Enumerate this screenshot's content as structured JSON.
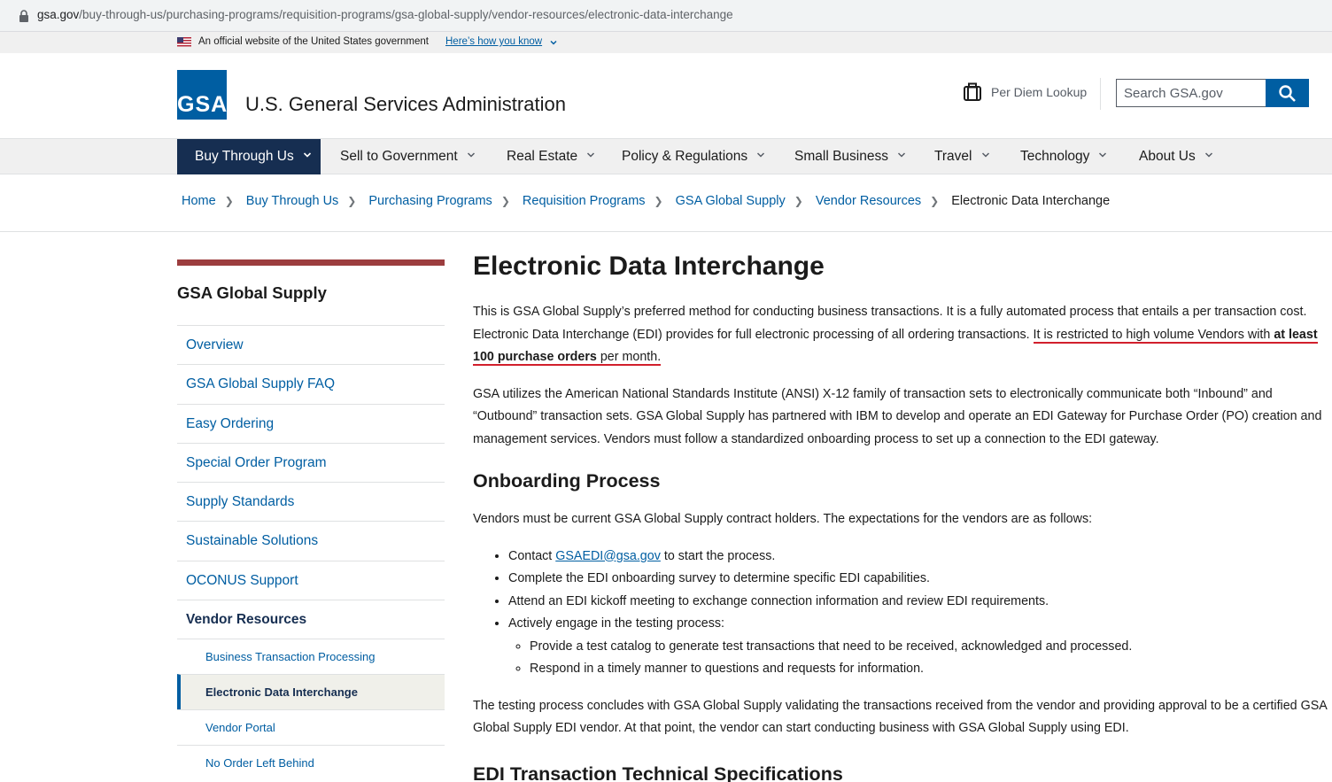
{
  "browser": {
    "url_host": "gsa.gov",
    "url_path": "/buy-through-us/purchasing-programs/requisition-programs/gsa-global-supply/vendor-resources/electronic-data-interchange"
  },
  "gov_banner": {
    "text": "An official website of the United States government",
    "link": "Here’s how you know"
  },
  "header": {
    "logo_text": "GSA",
    "agency_name": "U.S. General Services Administration",
    "per_diem": "Per Diem Lookup",
    "search_placeholder": "Search GSA.gov"
  },
  "nav": {
    "items": [
      {
        "label": "Buy Through Us",
        "active": true
      },
      {
        "label": "Sell to Government"
      },
      {
        "label": "Real Estate"
      },
      {
        "label": "Policy & Regulations"
      },
      {
        "label": "Small Business"
      },
      {
        "label": "Travel"
      },
      {
        "label": "Technology"
      },
      {
        "label": "About Us"
      }
    ]
  },
  "breadcrumb": {
    "items": [
      "Home",
      "Buy Through Us",
      "Purchasing Programs",
      "Requisition Programs",
      "GSA Global Supply",
      "Vendor Resources"
    ],
    "current": "Electronic Data Interchange"
  },
  "sidebar": {
    "title": "GSA Global Supply",
    "items": [
      "Overview",
      "GSA Global Supply FAQ",
      "Easy Ordering",
      "Special Order Program",
      "Supply Standards",
      "Sustainable Solutions",
      "OCONUS Support",
      "Vendor Resources"
    ],
    "subitems": [
      "Business Transaction Processing",
      "Electronic Data Interchange",
      "Vendor Portal",
      "No Order Left Behind"
    ]
  },
  "main": {
    "title": "Electronic Data Interchange",
    "p1_a": "This is GSA Global Supply’s preferred method for conducting business transactions. It is a fully automated process that entails a per transaction cost. Electronic Data Interchange (EDI) provides for full electronic processing of all ordering transactions. ",
    "p1_b": "It is restricted to high volume Vendors with ",
    "p1_bold": "at least 100 purchase orders",
    "p1_c": " per month.",
    "p2": "GSA utilizes the American National Standards Institute (ANSI) X-12 family of transaction sets to electronically communicate both “Inbound” and “Outbound” transaction sets. GSA Global Supply has partnered with IBM to develop and operate an EDI Gateway for Purchase Order (PO) creation and management services. Vendors must follow a standardized onboarding process to set up a connection to the EDI gateway.",
    "h2_onboarding": "Onboarding Process",
    "p3": "Vendors must be current GSA Global Supply contract holders. The expectations for the vendors are as follows:",
    "b1_pre": "Contact ",
    "b1_link": "GSAEDI@gsa.gov",
    "b1_post": " to start the process.",
    "b2": "Complete the EDI onboarding survey to determine specific EDI capabilities.",
    "b3": "Attend an EDI kickoff meeting to exchange connection information and review EDI requirements.",
    "b4": "Actively engage in the testing process:",
    "b4_1": "Provide a test catalog to generate test transactions that need to be received, acknowledged and processed.",
    "b4_2": "Respond in a timely manner to questions and requests for information.",
    "p4": "The testing process concludes with GSA Global Supply validating the transactions received from the vendor and providing approval to be a certified GSA Global Supply EDI vendor. At that point, the vendor can start conducting business with GSA Global Supply using EDI.",
    "h2_specs": "EDI Transaction Technical Specifications"
  },
  "colors": {
    "primary": "#005ea2",
    "nav_active": "#162e51",
    "sidebar_accent": "#9c3d3e",
    "highlight_underline": "#d21f2c"
  }
}
